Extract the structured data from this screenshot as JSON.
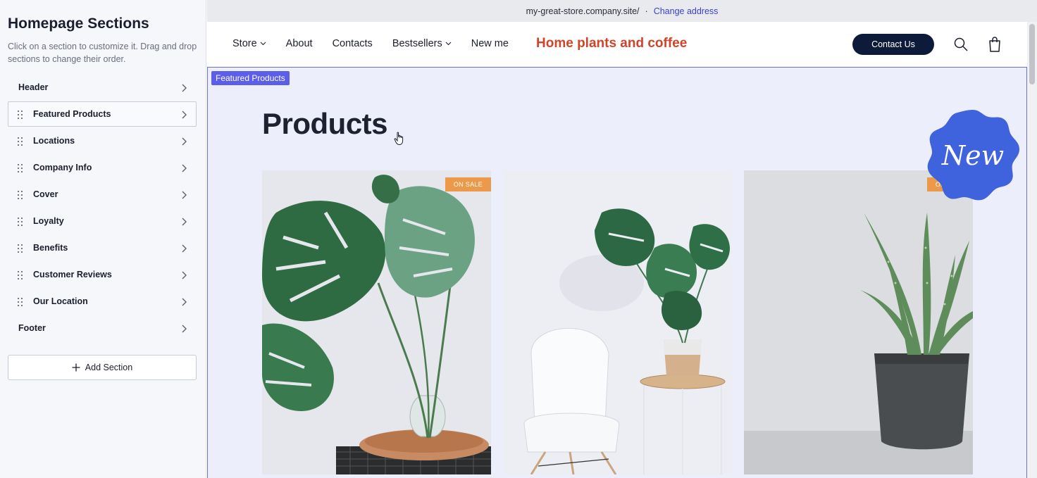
{
  "sidebar": {
    "title": "Homepage Sections",
    "description": "Click on a section to customize it. Drag and drop sections to change their order.",
    "sections": [
      {
        "label": "Header"
      },
      {
        "label": "Featured Products"
      },
      {
        "label": "Locations"
      },
      {
        "label": "Company Info"
      },
      {
        "label": "Cover"
      },
      {
        "label": "Loyalty"
      },
      {
        "label": "Benefits"
      },
      {
        "label": "Customer Reviews"
      },
      {
        "label": "Our Location"
      },
      {
        "label": "Footer"
      }
    ],
    "add_section_label": "Add Section"
  },
  "address_bar": {
    "url": "my-great-store.company.site/",
    "separator": "·",
    "change_label": "Change address"
  },
  "site_header": {
    "nav": [
      {
        "label": "Store"
      },
      {
        "label": "About"
      },
      {
        "label": "Contacts"
      },
      {
        "label": "Bestsellers"
      },
      {
        "label": "New me"
      }
    ],
    "store_name": "Home plants and coffee",
    "contact_label": "Contact Us"
  },
  "featured": {
    "tag": "Featured Products",
    "title": "Products",
    "new_badge": "New",
    "products": [
      {
        "badge": "ON SALE"
      },
      {
        "badge": ""
      },
      {
        "badge": "ON SALE"
      }
    ]
  },
  "colors": {
    "accent": "#5a5ee8",
    "brand": "#d0442a",
    "button_dark": "#0d1a3a",
    "sale": "#ec9a4a",
    "new_badge": "#3f63dc"
  }
}
